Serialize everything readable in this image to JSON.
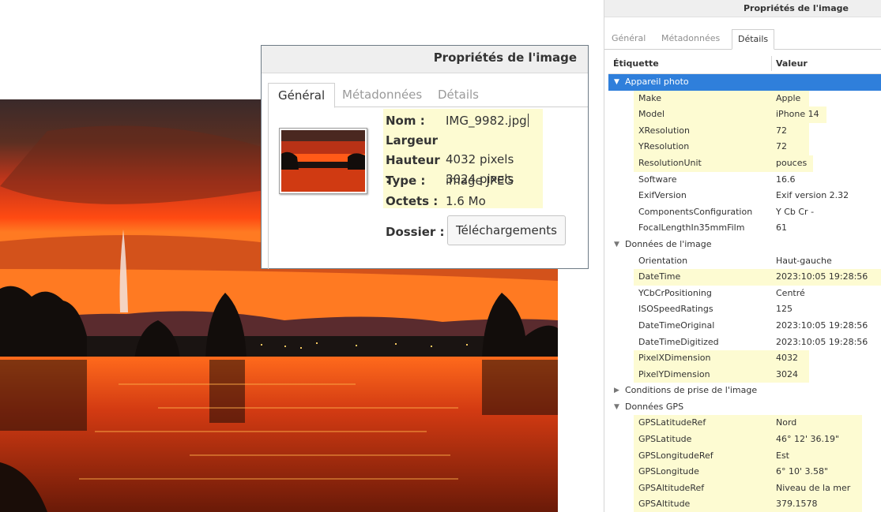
{
  "dialog": {
    "title": "Propriétés de l'image",
    "tabs": [
      "Général",
      "Métadonnées",
      "Détails"
    ],
    "fields": [
      {
        "key": "Nom :",
        "value": "IMG_9982.jpg"
      },
      {
        "key": "Largeur :",
        "value": "4032 pixels"
      },
      {
        "key": "Hauteur :",
        "value": "3024 pixels"
      },
      {
        "key": "Type :",
        "value": "image JPEG"
      },
      {
        "key": "Octets :",
        "value": "1.6 Mo"
      }
    ],
    "folder_label": "Dossier :",
    "folder_button": "Téléchargements"
  },
  "panel": {
    "title": "Propriétés de l'image",
    "tabs": [
      "Général",
      "Métadonnées",
      "Détails"
    ],
    "columns": [
      "Étiquette",
      "Valeur"
    ],
    "groups": {
      "appareil": "Appareil photo",
      "donnees": "Données de l'image",
      "conditions": "Conditions de prise de l'image",
      "gps": "Données GPS"
    },
    "rows": {
      "make": {
        "label": "Make",
        "value": "Apple"
      },
      "model": {
        "label": "Model",
        "value": "iPhone 14"
      },
      "xres": {
        "label": "XResolution",
        "value": "72"
      },
      "yres": {
        "label": "YResolution",
        "value": "72"
      },
      "resunit": {
        "label": "ResolutionUnit",
        "value": "pouces"
      },
      "software": {
        "label": "Software",
        "value": "16.6"
      },
      "exifver": {
        "label": "ExifVersion",
        "value": "Exif version 2.32"
      },
      "compconf": {
        "label": "ComponentsConfiguration",
        "value": "Y Cb Cr -"
      },
      "focal35": {
        "label": "FocalLengthIn35mmFilm",
        "value": "61"
      },
      "orientation": {
        "label": "Orientation",
        "value": "Haut-gauche"
      },
      "datetime": {
        "label": "DateTime",
        "value": "2023:10:05 19:28:56"
      },
      "ycbcr": {
        "label": "YCbCrPositioning",
        "value": "Centré"
      },
      "iso": {
        "label": "ISOSpeedRatings",
        "value": "125"
      },
      "dtoriginal": {
        "label": "DateTimeOriginal",
        "value": "2023:10:05 19:28:56"
      },
      "dtdigitized": {
        "label": "DateTimeDigitized",
        "value": "2023:10:05 19:28:56"
      },
      "pxx": {
        "label": "PixelXDimension",
        "value": "4032"
      },
      "pxy": {
        "label": "PixelYDimension",
        "value": "3024"
      },
      "latref": {
        "label": "GPSLatitudeRef",
        "value": "Nord"
      },
      "lat": {
        "label": "GPSLatitude",
        "value": "46° 12' 36.19\""
      },
      "lonref": {
        "label": "GPSLongitudeRef",
        "value": "Est"
      },
      "lon": {
        "label": "GPSLongitude",
        "value": "6° 10' 3.58\""
      },
      "altref": {
        "label": "GPSAltitudeRef",
        "value": "Niveau de la mer"
      },
      "alt": {
        "label": "GPSAltitude",
        "value": "379.1578"
      }
    }
  },
  "colors": {
    "highlight": "#fdfbd2",
    "selection": "#2f7fdb",
    "sky_orange": "#ff5a1a"
  }
}
